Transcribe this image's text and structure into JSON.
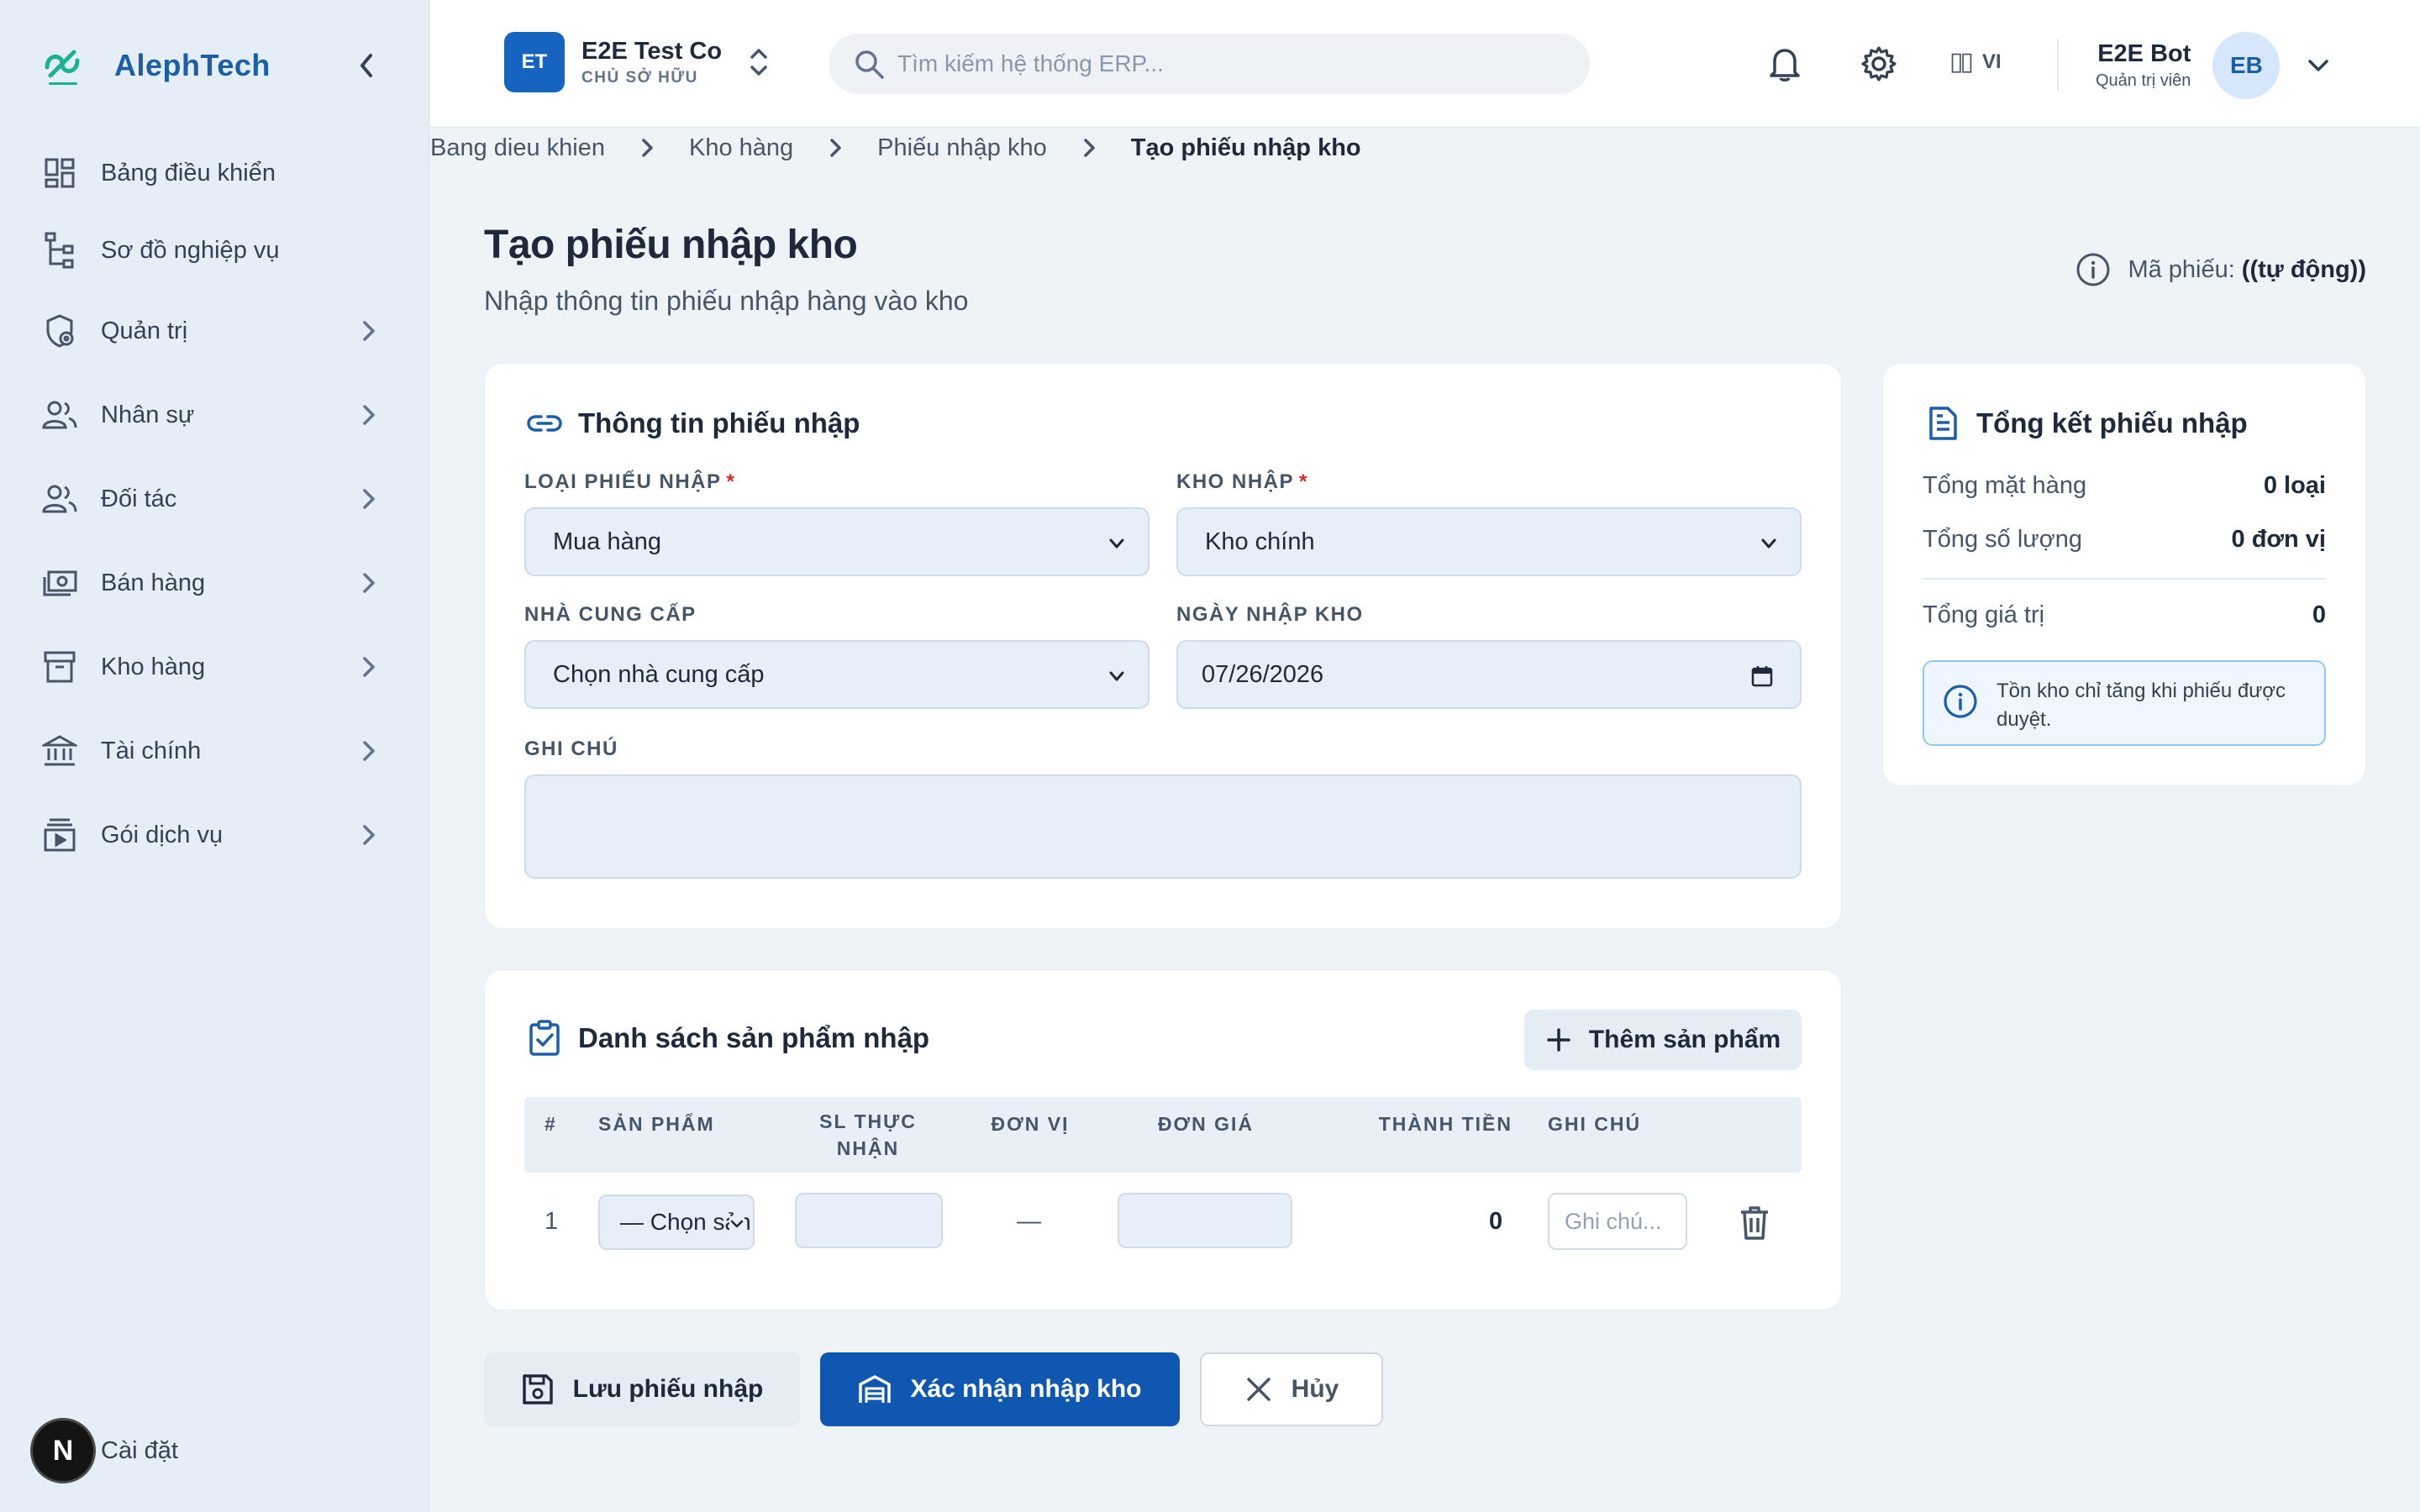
{
  "brand": {
    "name": "AlephTech"
  },
  "sidebar": {
    "items": [
      {
        "label": "Bảng điều khiển",
        "icon": "dashboard-icon"
      },
      {
        "label": "Sơ đồ nghiệp vụ",
        "icon": "flowchart-icon"
      },
      {
        "label": "Quản trị",
        "icon": "admin-shield-icon"
      },
      {
        "label": "Nhân sự",
        "icon": "people-icon"
      },
      {
        "label": "Đối tác",
        "icon": "partners-icon"
      },
      {
        "label": "Bán hàng",
        "icon": "cash-icon"
      },
      {
        "label": "Kho hàng",
        "icon": "archive-box-icon"
      },
      {
        "label": "Tài chính",
        "icon": "bank-icon"
      },
      {
        "label": "Gói dịch vụ",
        "icon": "subscription-icon"
      }
    ],
    "footer": {
      "badge": "N",
      "label": "Cài đặt"
    }
  },
  "header": {
    "company": {
      "initials": "ET",
      "name": "E2E Test Co",
      "role": "CHỦ SỞ HỮU"
    },
    "search": {
      "placeholder": "Tìm kiếm hệ thống ERP..."
    },
    "lang": {
      "flag": "▯▯",
      "code": "VI"
    },
    "user": {
      "name": "E2E Bot",
      "role": "Quản trị viên",
      "initials": "EB"
    }
  },
  "breadcrumb": [
    "Bang dieu khien",
    "Kho hàng",
    "Phiếu nhập kho",
    "Tạo phiếu nhập kho"
  ],
  "page": {
    "title": "Tạo phiếu nhập kho",
    "subtitle": "Nhập thông tin phiếu nhập hàng vào kho",
    "code_label": "Mã phiếu:",
    "code_value": "((tự động))"
  },
  "form": {
    "title": "Thông tin phiếu nhập",
    "type": {
      "label": "LOẠI PHIẾU NHẬP",
      "value": "Mua hàng"
    },
    "warehouse": {
      "label": "KHO NHẬP",
      "value": "Kho chính"
    },
    "supplier": {
      "label": "NHÀ CUNG CẤP",
      "value": "Chọn nhà cung cấp"
    },
    "date": {
      "label": "NGÀY NHẬP KHO",
      "value": "07/26/2026"
    },
    "note": {
      "label": "GHI CHÚ",
      "value": ""
    },
    "required_mark": "*"
  },
  "products": {
    "title": "Danh sách sản phẩm nhập",
    "add_label": "Thêm sản phẩm",
    "columns": [
      "#",
      "SẢN PHẨM",
      "SL THỰC NHẬN",
      "ĐƠN VỊ",
      "ĐƠN GIÁ",
      "THÀNH TIỀN",
      "GHI CHÚ"
    ],
    "rows": [
      {
        "num": "1",
        "product": "— Chọn sản phẩm —",
        "qty": "",
        "unit": "—",
        "price": "",
        "total": "0",
        "note_placeholder": "Ghi chú..."
      }
    ]
  },
  "summary": {
    "title": "Tổng kết phiếu nhập",
    "items_label": "Tổng mặt hàng",
    "items_value": "0 loại",
    "qty_label": "Tổng số lượng",
    "qty_value": "0 đơn vị",
    "value_label": "Tổng giá trị",
    "value_value": "0",
    "info": "Tồn kho chỉ tăng khi phiếu được duyệt."
  },
  "actions": {
    "save": "Lưu phiếu nhập",
    "confirm": "Xác nhận nhập kho",
    "cancel": "Hủy"
  },
  "colors": {
    "primary": "#0f57b0",
    "brand": "#1a5fa8",
    "logo_green": "#19b394",
    "danger": "#dc2626"
  }
}
